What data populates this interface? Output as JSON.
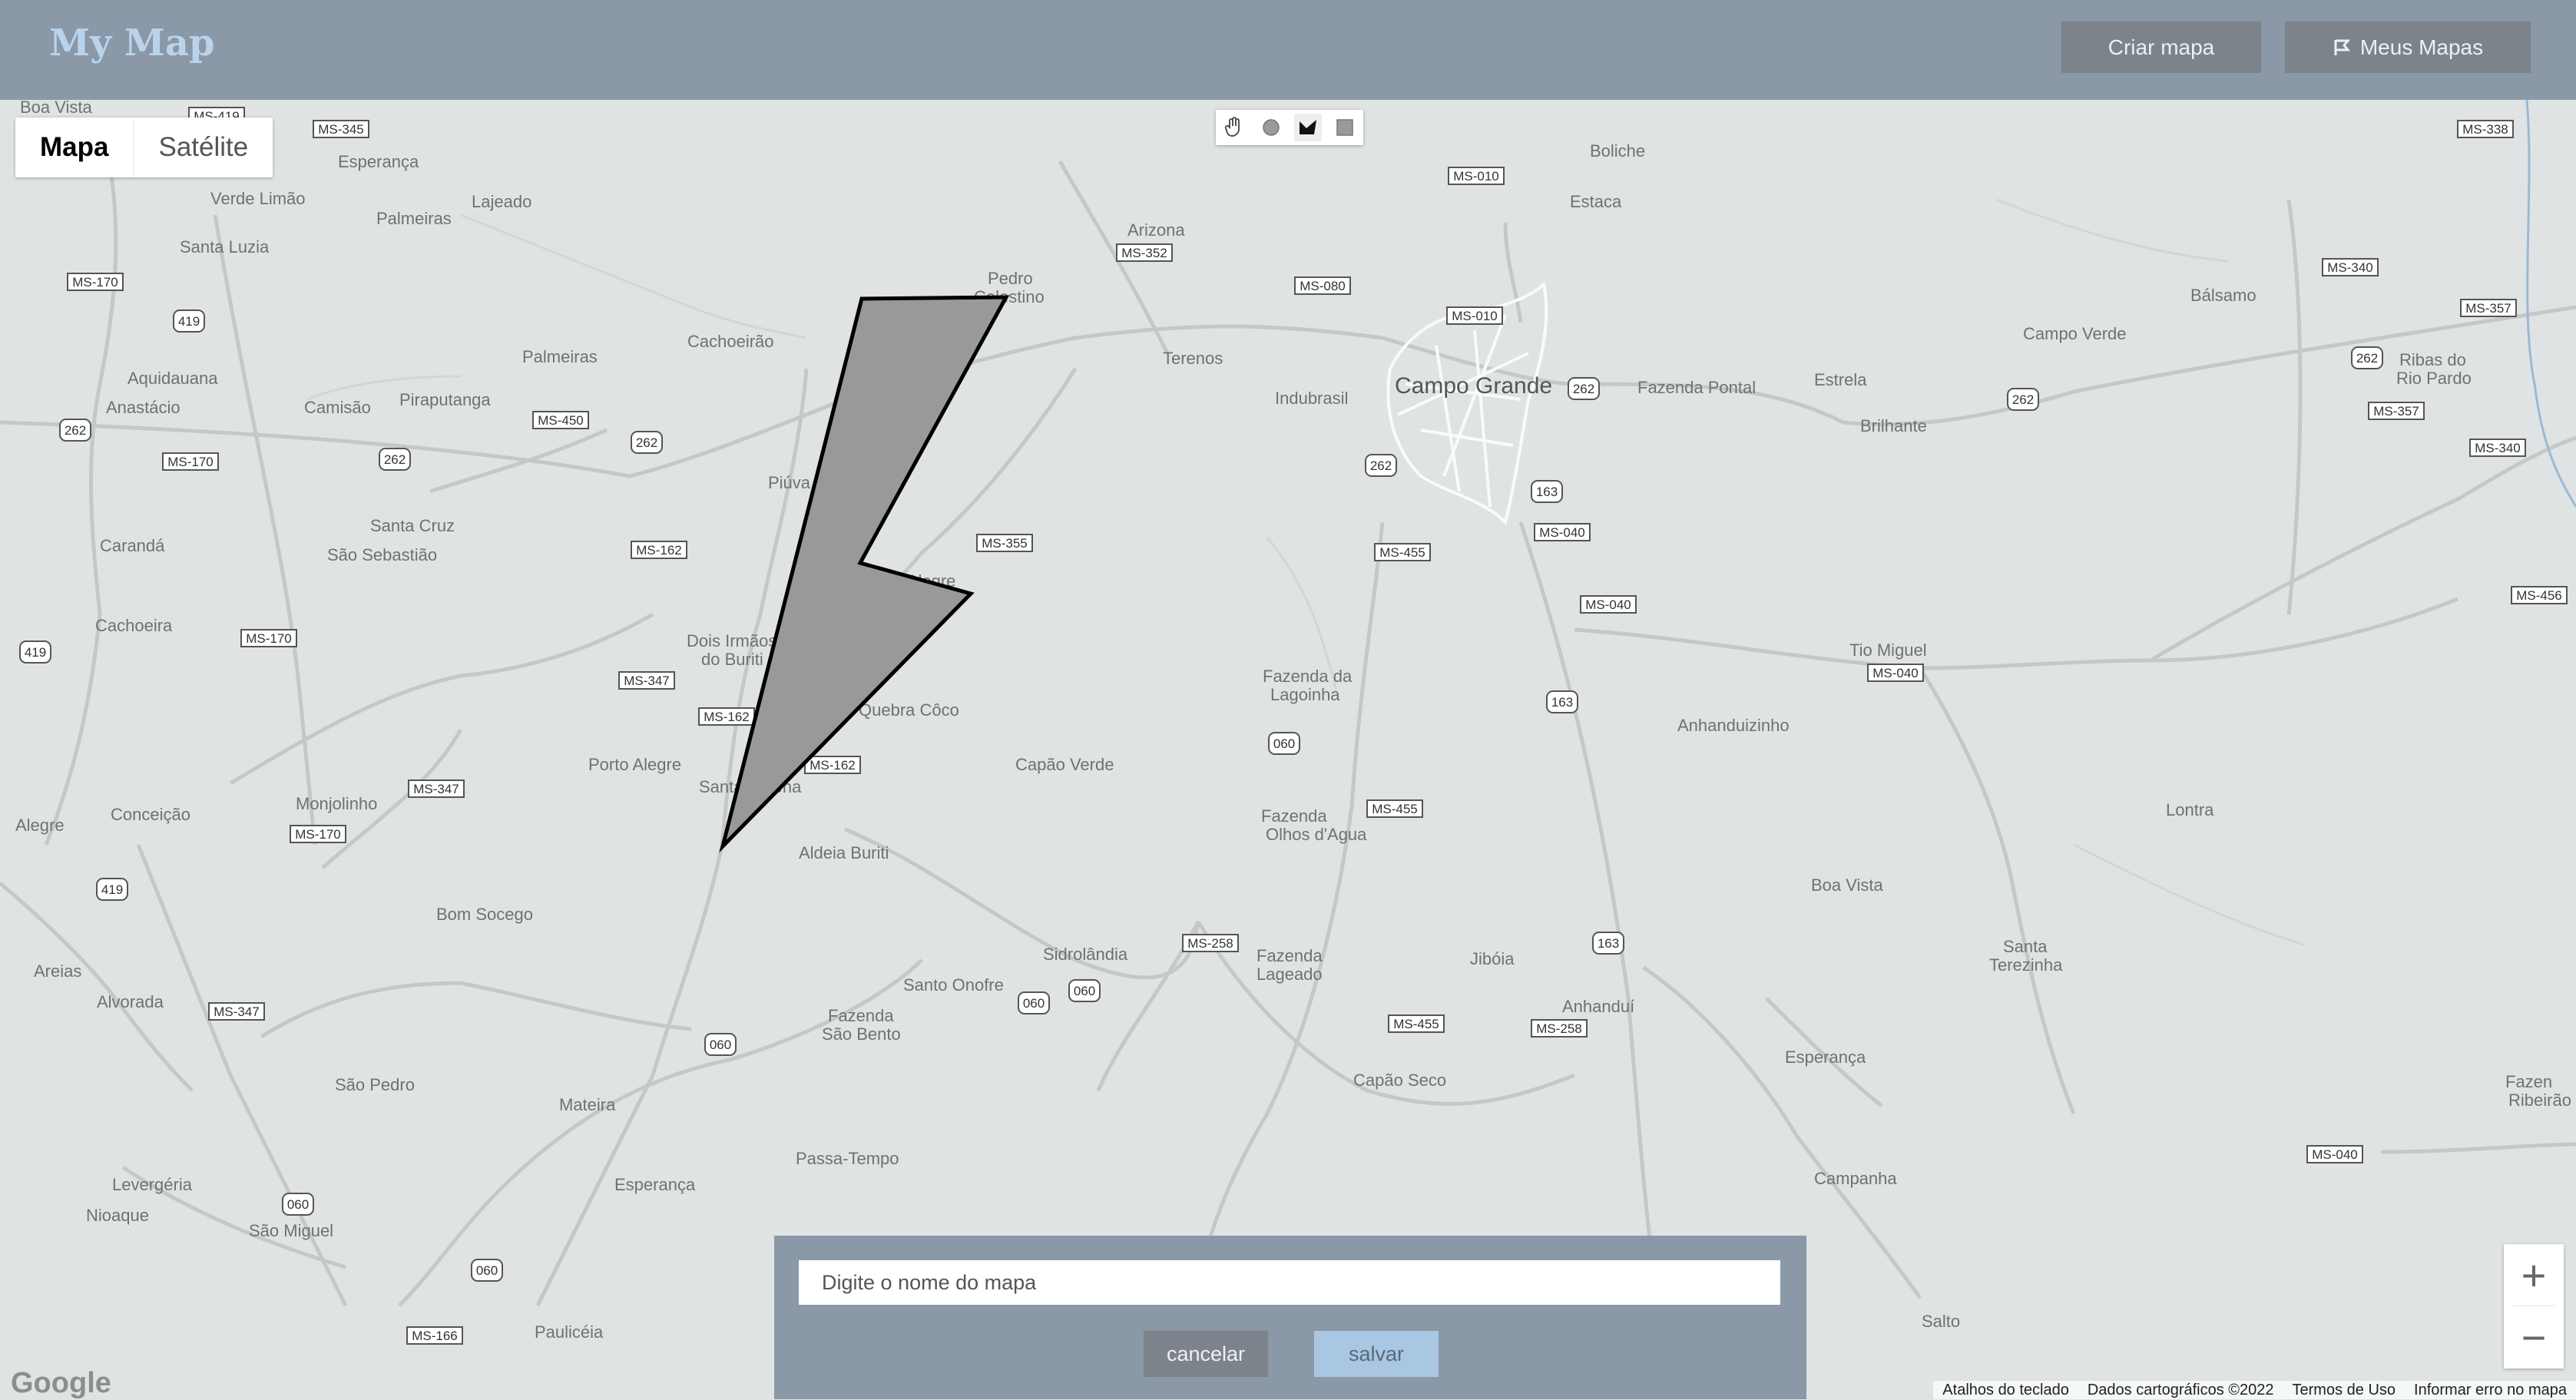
{
  "header": {
    "title": "My Map",
    "create_label": "Criar mapa",
    "my_maps_label": "Meus Mapas",
    "my_maps_icon": "map-flag-icon"
  },
  "map": {
    "type_control": {
      "map": "Mapa",
      "satellite": "Satélite",
      "selected": "Mapa"
    },
    "draw_tools": [
      "hand-icon",
      "circle-icon",
      "polygon-icon",
      "rectangle-icon"
    ],
    "zoom_in": "+",
    "zoom_out": "−",
    "google_logo": "Google",
    "footer": {
      "shortcuts": "Atalhos do teclado",
      "data": "Dados cartográficos ©2022",
      "terms": "Termos de Uso",
      "report": "Informar erro no mapa"
    },
    "places": [
      "Boa Vista",
      "Esperança",
      "Palmeiras",
      "Lajeado",
      "Verde Limão",
      "Santa Luzia",
      "Aquidauana",
      "Anastácio",
      "Camisão",
      "Piraputanga",
      "Palmeiras",
      "Cachoeirão",
      "Pedro Celestino",
      "Arizona",
      "Terenos",
      "Indubrasil",
      "Campo Grande",
      "Fazenda Pontal",
      "Estrela",
      "Brilhante",
      "Campo Verde",
      "Bálsamo",
      "Ribas do Rio Pardo",
      "Boliche",
      "Estaca",
      "Piúva",
      "Santa Cruz",
      "São Sebastião",
      "Carandá",
      "Cachoeira",
      "Campo Alegre",
      "Dois Irmãos do Buriti",
      "Quebra Côco",
      "Capão Verde",
      "Fazenda da Lagoinha",
      "Anhanduizinho",
      "Tio Miguel",
      "Porto Alegre",
      "Santa Helena",
      "Conceição",
      "Monjolinho",
      "Alegre",
      "Aldeia Buriti",
      "Bom Socego",
      "Fazenda Olhos d'Agua",
      "Lontra",
      "Boa Vista",
      "Areias",
      "Alvorada",
      "Sidrolândia",
      "Santo Onofre",
      "Fazenda Lageado",
      "Jibóia",
      "Santa Terezinha",
      "Fazenda São Bento",
      "Anhanduí",
      "São Pedro",
      "Mateira",
      "Capão Seco",
      "Esperança",
      "Passa-Tempo",
      "Esperança",
      "Campanha",
      "Levergéria",
      "Nioaque",
      "São Miguel",
      "Paulicéia",
      "Salto",
      "Fazenda Ribeirão"
    ]
  },
  "save_panel": {
    "name_placeholder": "Digite o nome do mapa",
    "name_value": "",
    "cancel_label": "cancelar",
    "save_label": "salvar"
  },
  "colors": {
    "header_bg": "#8a98a7",
    "title": "#b9d3ec",
    "button_bg": "#7c838a",
    "save_bg": "#a9c6e3",
    "map_bg": "#e0e3e3",
    "polygon_fill": "#999999"
  }
}
